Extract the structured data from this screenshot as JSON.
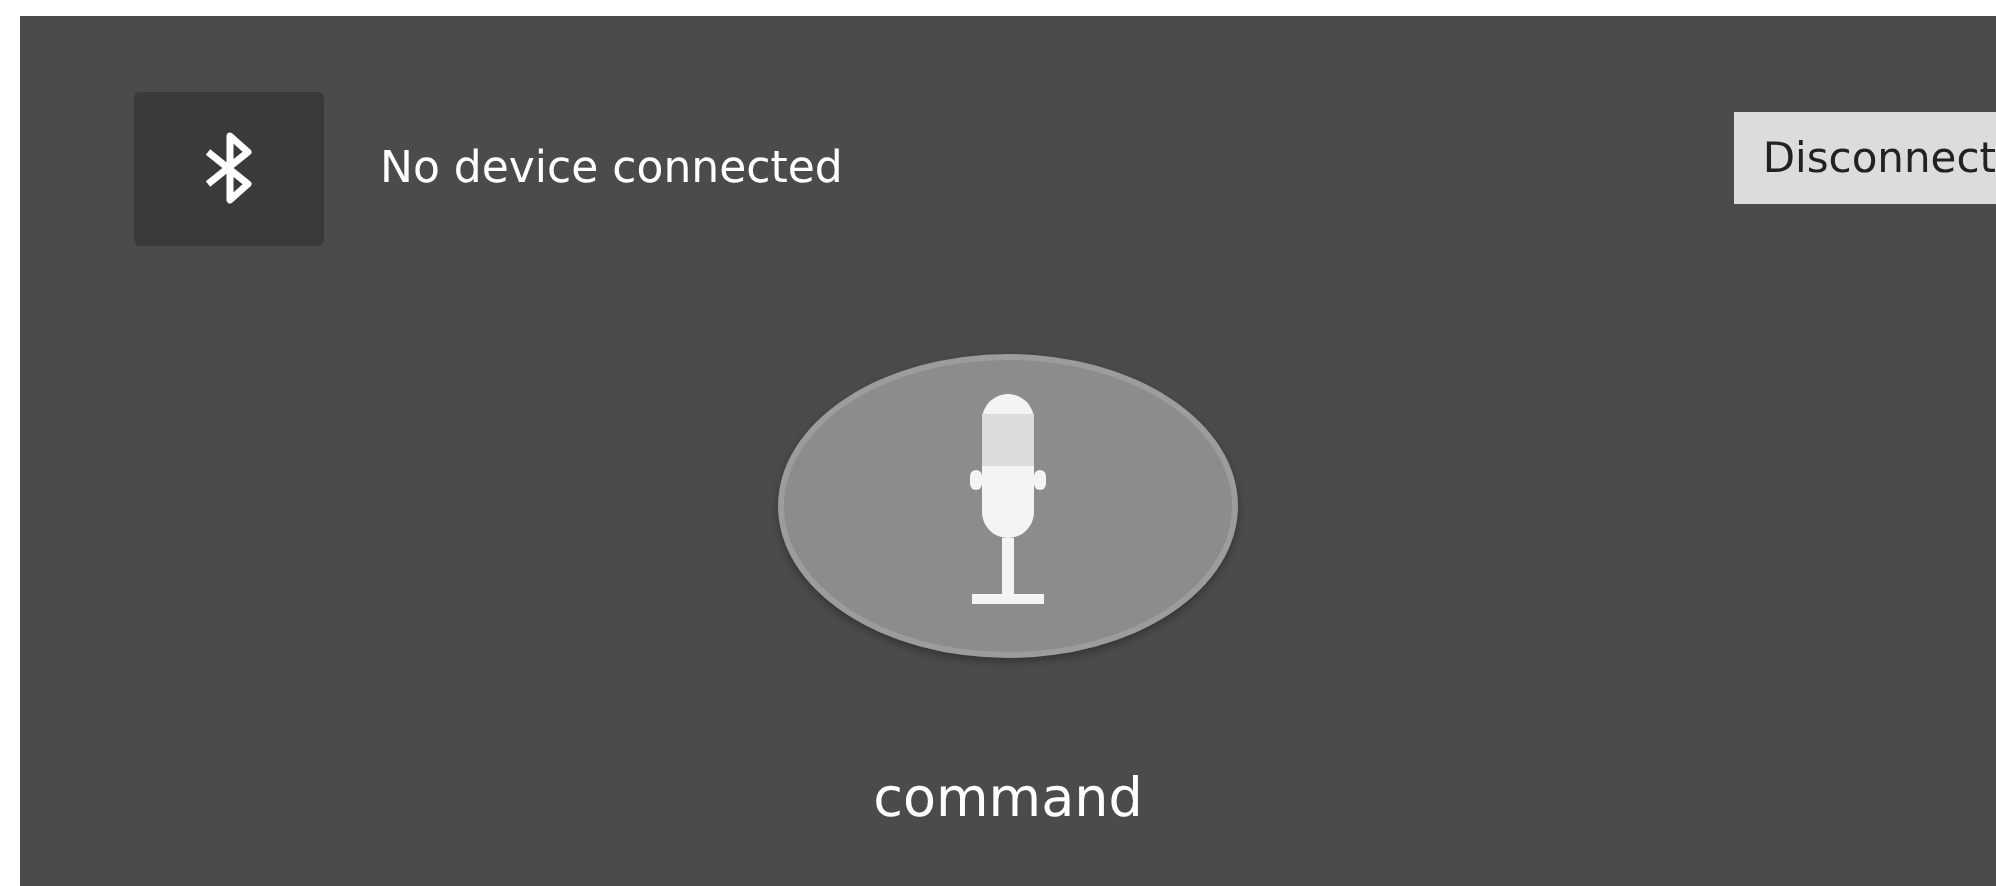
{
  "connection": {
    "status": "No device connected"
  },
  "disconnect_button": {
    "label": "Disconnect"
  },
  "voice": {
    "label": "command"
  }
}
